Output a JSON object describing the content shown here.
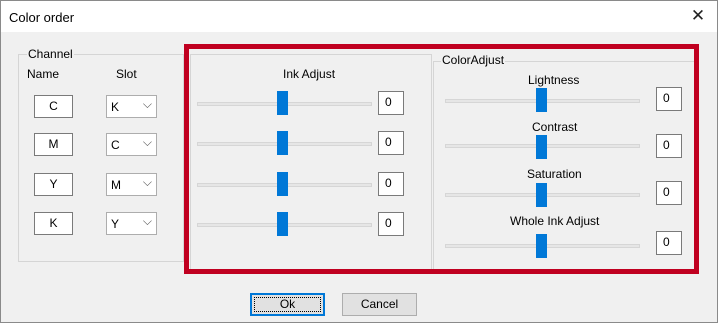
{
  "window": {
    "title": "Color order"
  },
  "channel": {
    "legend": "Channel",
    "name_header": "Name",
    "slot_header": "Slot",
    "rows": [
      {
        "name": "C",
        "slot": "K"
      },
      {
        "name": "M",
        "slot": "C"
      },
      {
        "name": "Y",
        "slot": "M"
      },
      {
        "name": "K",
        "slot": "Y"
      }
    ]
  },
  "ink_adjust": {
    "label": "Ink Adjust",
    "values": [
      "0",
      "0",
      "0",
      "0"
    ],
    "slider_levels": [
      0.5,
      0.5,
      0.5,
      0.5
    ]
  },
  "color_adjust": {
    "legend": "ColorAdjust",
    "lightness": {
      "label": "Lightness",
      "value": "0",
      "level": 0.5
    },
    "contrast": {
      "label": "Contrast",
      "value": "0",
      "level": 0.5
    },
    "saturation": {
      "label": "Saturation",
      "value": "0",
      "level": 0.5
    },
    "whole_ink": {
      "label": "Whole Ink Adjust",
      "value": "0",
      "level": 0.5
    }
  },
  "buttons": {
    "ok": "Ok",
    "cancel": "Cancel"
  },
  "colors": {
    "accent": "#0078d7",
    "highlight": "#c00020"
  }
}
